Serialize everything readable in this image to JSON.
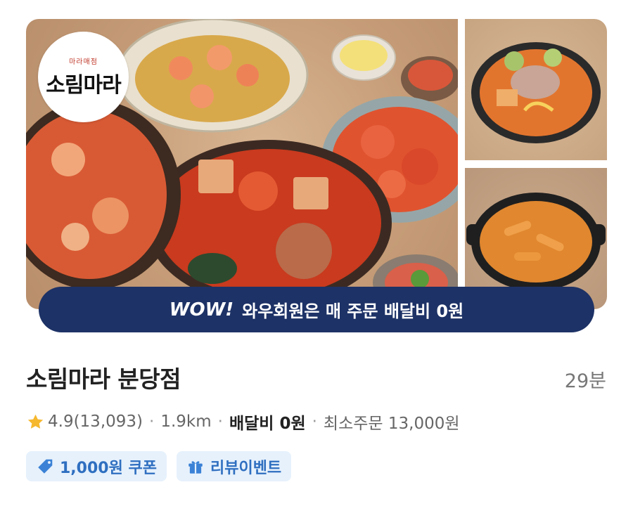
{
  "hero": {
    "logo_sub": "마라매점",
    "logo_text": "소림마라"
  },
  "banner": {
    "wow_label": "WOW!",
    "text": "와우회원은 매 주문 배달비 0원"
  },
  "store": {
    "name": "소림마라 분당점",
    "eta": "29분",
    "rating": "4.9(13,093)",
    "distance": "1.9km",
    "delivery_fee": "배달비 0원",
    "min_order": "최소주문 13,000원",
    "separator": "·"
  },
  "tags": [
    {
      "label": "1,000원 쿠폰",
      "icon": "coupon-tag-icon"
    },
    {
      "label": "리뷰이벤트",
      "icon": "gift-icon"
    }
  ],
  "colors": {
    "banner_bg": "#1d3266",
    "star": "#f5b82e",
    "tag_bg": "#e6f1fc",
    "tag_text": "#2f6fc0"
  }
}
